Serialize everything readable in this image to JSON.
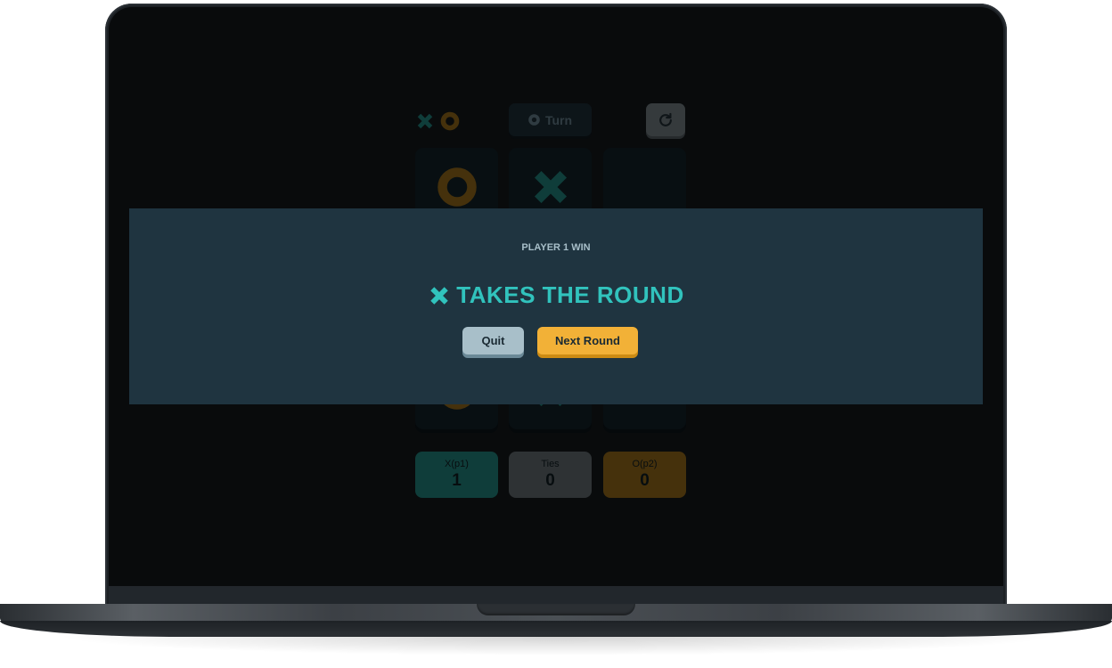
{
  "app": {
    "turn_label": "Turn",
    "board": [
      "o",
      "x",
      "",
      "",
      "",
      "",
      "o",
      "x",
      ""
    ],
    "scores": [
      {
        "label": "X(p1)",
        "value": "1",
        "color": "#1f7a74"
      },
      {
        "label": "Ties",
        "value": "0",
        "color": "#5d6569"
      },
      {
        "label": "O(p2)",
        "value": "0",
        "color": "#8a6318"
      }
    ]
  },
  "modal": {
    "label": "PLAYER 1 WIN",
    "title": "TAKES THE ROUND",
    "winner_icon": "x-icon",
    "quit_label": "Quit",
    "next_label": "Next Round"
  },
  "colors": {
    "x": "#31c3bd",
    "o": "#f2b137",
    "silver": "#a8bfc9",
    "navy": "#1a2a33"
  }
}
